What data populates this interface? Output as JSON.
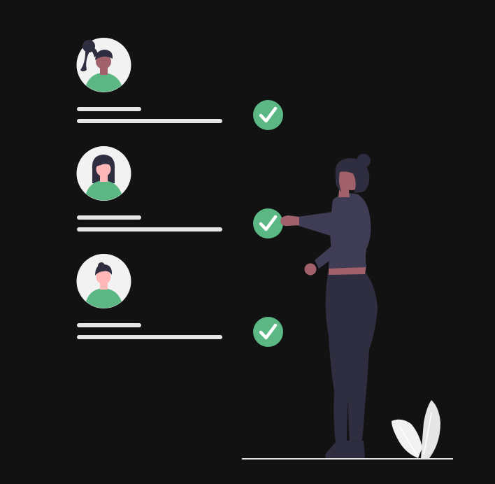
{
  "theme": {
    "background": "#121212",
    "accent_green": "#5bb783",
    "line_color": "#e6e6e6",
    "avatar_bg": "#f2f2f2",
    "dark_figure": "#2f2e41",
    "top_figure": "#3f3d56",
    "skin_dark": "#a0616a",
    "skin_light": "#ffb8b8"
  },
  "entries": [
    {
      "avatar": "person-ponytail-avatar",
      "status": "checked"
    },
    {
      "avatar": "person-long-hair-avatar",
      "status": "checked"
    },
    {
      "avatar": "person-short-hair-avatar",
      "status": "checked"
    }
  ],
  "illustration": {
    "figure": "standing-woman-pointing",
    "plant": "leaf-plant"
  }
}
